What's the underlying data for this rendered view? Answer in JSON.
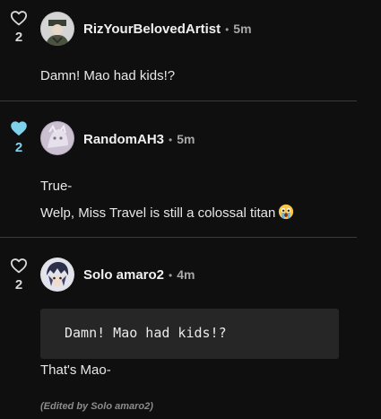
{
  "comments": [
    {
      "username": "RizYourBelovedArtist",
      "time": "5m",
      "separator": "•",
      "likes": "2",
      "liked": false,
      "lines": [
        "Damn! Mao had kids!?"
      ]
    },
    {
      "username": "RandomAH3",
      "time": "5m",
      "separator": "•",
      "likes": "2",
      "liked": true,
      "lines": [
        "True-",
        "Welp, Miss Travel is still a colossal titan"
      ],
      "emoji": "crying-face-emoji"
    },
    {
      "username": "Solo amaro2",
      "time": "4m",
      "separator": "•",
      "likes": "2",
      "liked": false,
      "code_block": "Damn! Mao had kids!?",
      "lines": [
        "That's Mao-"
      ],
      "edited_note": "(Edited by Solo amaro2)"
    }
  ],
  "colors": {
    "background": "#0f0f0f",
    "liked_heart": "#7fd2ec",
    "divider": "#3a3a3a",
    "code_background": "#262626"
  }
}
